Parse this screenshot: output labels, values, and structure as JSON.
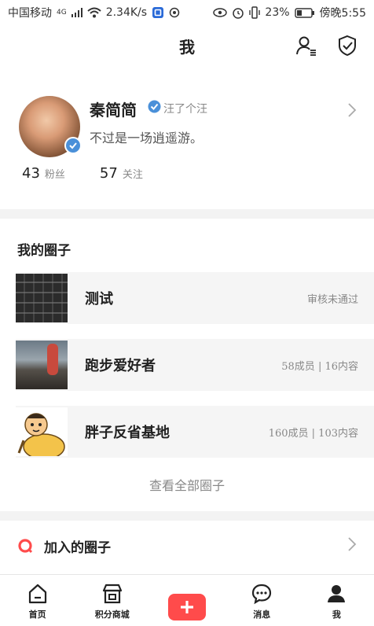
{
  "status_bar": {
    "carrier": "中国移动",
    "network": "4G",
    "speed": "2.34K/s",
    "battery": "23%",
    "time": "傍晚5:55"
  },
  "nav": {
    "title": "我",
    "icons": [
      "user-list-icon",
      "shield-check-icon"
    ]
  },
  "profile": {
    "name": "秦简简",
    "verified_label": "汪了个汪",
    "bio": "不过是一场逍遥游。",
    "followers_count": "43",
    "followers_label": "粉丝",
    "following_count": "57",
    "following_label": "关注"
  },
  "my_circles": {
    "title": "我的圈子",
    "items": [
      {
        "name": "测试",
        "meta": "审核未通过"
      },
      {
        "name": "跑步爱好者",
        "meta": "58成员 | 16内容"
      },
      {
        "name": "胖子反省基地",
        "meta": "160成员 | 103内容"
      }
    ],
    "view_all": "查看全部圈子"
  },
  "joined": {
    "label": "加入的圈子"
  },
  "tabs": [
    {
      "label": "首页",
      "icon": "home-icon"
    },
    {
      "label": "积分商城",
      "icon": "store-icon"
    },
    {
      "label": "",
      "icon": "add-icon"
    },
    {
      "label": "消息",
      "icon": "message-icon"
    },
    {
      "label": "我",
      "icon": "profile-icon"
    }
  ],
  "colors": {
    "accent": "#ff4b4b",
    "verify": "#4a90d9"
  }
}
